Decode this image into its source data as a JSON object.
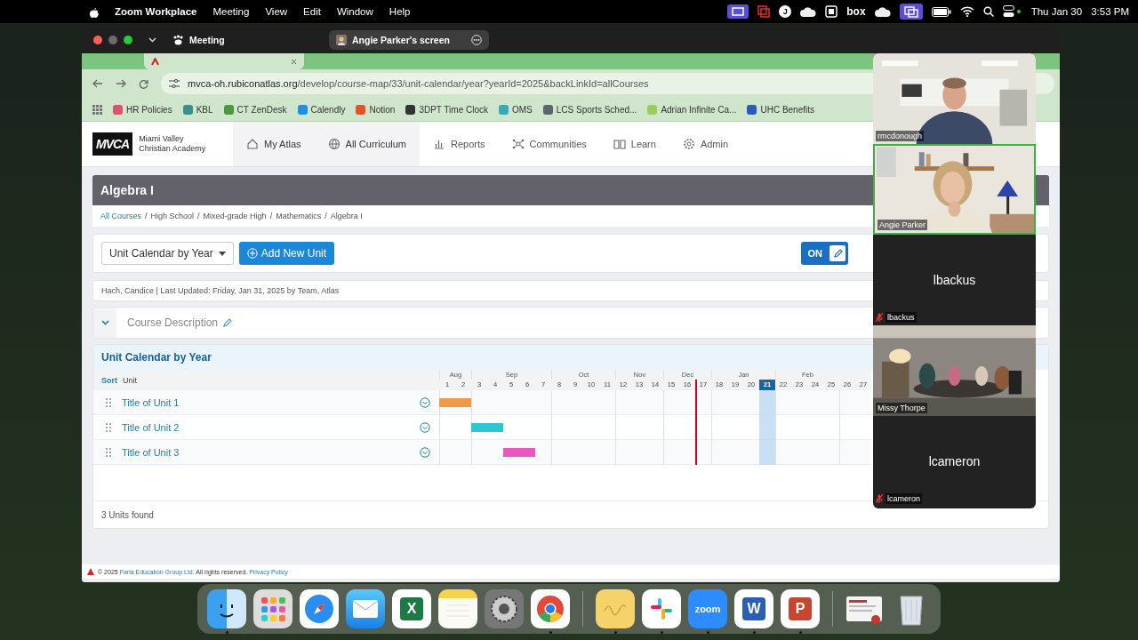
{
  "menubar": {
    "app": "Zoom Workplace",
    "menus": [
      "Meeting",
      "View",
      "Edit",
      "Window",
      "Help"
    ],
    "status_items": [
      {
        "kind": "share"
      },
      {
        "kind": "record"
      },
      {
        "kind": "badge",
        "label": "J"
      },
      {
        "kind": "cloud"
      },
      {
        "kind": "mail"
      },
      {
        "kind": "text",
        "label": "box"
      },
      {
        "kind": "cloud"
      },
      {
        "kind": "screens"
      },
      {
        "kind": "battery"
      },
      {
        "kind": "wifi"
      },
      {
        "kind": "search"
      },
      {
        "kind": "controls"
      }
    ],
    "date": "Thu Jan 30",
    "time": "3:53 PM"
  },
  "zoom_window": {
    "title": "Meeting",
    "share_pill": "Angie Parker's screen"
  },
  "browser": {
    "url_host": "mvca-oh.rubiconatlas.org",
    "url_path": "/develop/course-map/33/unit-calendar/year?yearId=2025&backLinkId=allCourses",
    "bookmarks": [
      {
        "label": "HR Policies",
        "color": "#d9546e"
      },
      {
        "label": "KBL",
        "color": "#3a8f8f"
      },
      {
        "label": "CT ZenDesk",
        "color": "#4a9a3c"
      },
      {
        "label": "Calendly",
        "color": "#1f8fe0"
      },
      {
        "label": "Notion",
        "color": "#e0562a"
      },
      {
        "label": "3DPT Time Clock",
        "color": "#333333"
      },
      {
        "label": "OMS",
        "color": "#3aa8b8"
      },
      {
        "label": "LCS Sports Sched...",
        "color": "#5c6470"
      },
      {
        "label": "Adrian Infinite Ca...",
        "color": "#9acd5a"
      },
      {
        "label": "UHC Benefits",
        "color": "#2a5cb8"
      }
    ]
  },
  "site": {
    "logo": "MVCA",
    "school_line_1": "Miami Valley",
    "school_line_2": "Christian Academy",
    "nav": [
      {
        "label": "My Atlas",
        "selected": true
      },
      {
        "label": "All Curriculum",
        "selected": true
      },
      {
        "label": "Reports",
        "selected": false
      },
      {
        "label": "Communities",
        "selected": false
      },
      {
        "label": "Learn",
        "selected": false
      },
      {
        "label": "Admin",
        "selected": false
      }
    ]
  },
  "course": {
    "title": "Algebra I",
    "breadcrumbs": [
      {
        "kind": "link",
        "label": "All Courses"
      },
      {
        "kind": "separator",
        "label": "/"
      },
      {
        "kind": "text",
        "label": "High School"
      },
      {
        "kind": "separator",
        "label": "/"
      },
      {
        "kind": "text",
        "label": "Mixed-grade High"
      },
      {
        "kind": "separator",
        "label": "/"
      },
      {
        "kind": "text",
        "label": "Mathematics"
      },
      {
        "kind": "separator",
        "label": "/"
      },
      {
        "kind": "text",
        "label": "Algebra I"
      }
    ],
    "view_select": "Unit Calendar by Year",
    "add_button": "Add New Unit",
    "edit_toggle": {
      "label": "ON",
      "on": true
    },
    "meta": "Hach, Candice | Last Updated: Friday, Jan 31, 2025 by Team, Atlas",
    "description": {
      "label": "Course Description",
      "expanded": true
    }
  },
  "calendar": {
    "title": "Unit Calendar by Year",
    "sort": "Sort",
    "unit_column": "Unit",
    "months": [
      "Aug",
      "Sep",
      "Oct",
      "Nov",
      "Dec",
      "Jan",
      "Feb"
    ],
    "weeks": [
      {
        "label": "1",
        "month_start": true,
        "selected": false,
        "today": false
      },
      {
        "label": "2",
        "month_start": false,
        "selected": false,
        "today": false
      },
      {
        "label": "3",
        "month_start": true,
        "selected": false,
        "today": false
      },
      {
        "label": "4",
        "month_start": false,
        "selected": false,
        "today": false
      },
      {
        "label": "5",
        "month_start": false,
        "selected": false,
        "today": false
      },
      {
        "label": "6",
        "month_start": false,
        "selected": false,
        "today": false
      },
      {
        "label": "7",
        "month_start": false,
        "selected": false,
        "today": false
      },
      {
        "label": "8",
        "month_start": true,
        "selected": false,
        "today": false
      },
      {
        "label": "9",
        "month_start": false,
        "selected": false,
        "today": false
      },
      {
        "label": "10",
        "month_start": false,
        "selected": false,
        "today": false
      },
      {
        "label": "11",
        "month_start": false,
        "selected": false,
        "today": false
      },
      {
        "label": "12",
        "month_start": true,
        "selected": false,
        "today": false
      },
      {
        "label": "13",
        "month_start": false,
        "selected": false,
        "today": false
      },
      {
        "label": "14",
        "month_start": false,
        "selected": false,
        "today": false
      },
      {
        "label": "15",
        "month_start": true,
        "selected": false,
        "today": false
      },
      {
        "label": "16",
        "month_start": false,
        "selected": false,
        "today": false
      },
      {
        "label": "17",
        "month_start": false,
        "selected": false,
        "today": true
      },
      {
        "label": "18",
        "month_start": true,
        "selected": false,
        "today": false
      },
      {
        "label": "19",
        "month_start": false,
        "selected": false,
        "today": false
      },
      {
        "label": "20",
        "month_start": false,
        "selected": false,
        "today": false
      },
      {
        "label": "21",
        "month_start": false,
        "selected": true,
        "today": false
      },
      {
        "label": "22",
        "month_start": true,
        "selected": false,
        "today": false
      },
      {
        "label": "23",
        "month_start": false,
        "selected": false,
        "today": false
      },
      {
        "label": "24",
        "month_start": false,
        "selected": false,
        "today": false
      },
      {
        "label": "25",
        "month_start": false,
        "selected": false,
        "today": false
      },
      {
        "label": "26",
        "month_start": true,
        "selected": false,
        "today": false
      },
      {
        "label": "27",
        "month_start": false,
        "selected": false,
        "today": false
      }
    ],
    "units": [
      {
        "title": "Title of Unit 1",
        "color": "#f0994a",
        "weeks": [
          true,
          true,
          false,
          false,
          false,
          false,
          false,
          false,
          false,
          false,
          false,
          false,
          false,
          false,
          false,
          false,
          false,
          false,
          false,
          false,
          false,
          false,
          false,
          false,
          false,
          false,
          false
        ]
      },
      {
        "title": "Title of Unit 2",
        "color": "#2ac8d0",
        "weeks": [
          false,
          false,
          true,
          true,
          false,
          false,
          false,
          false,
          false,
          false,
          false,
          false,
          false,
          false,
          false,
          false,
          false,
          false,
          false,
          false,
          false,
          false,
          false,
          false,
          false,
          false,
          false
        ]
      },
      {
        "title": "Title of Unit 3",
        "color": "#e858c0",
        "weeks": [
          false,
          false,
          false,
          false,
          true,
          true,
          false,
          false,
          false,
          false,
          false,
          false,
          false,
          false,
          false,
          false,
          false,
          false,
          false,
          false,
          false,
          false,
          false,
          false,
          false,
          false,
          false
        ]
      }
    ],
    "count": "3 Units found"
  },
  "footer": {
    "prefix": "© 2025",
    "company_link": "Faria Education Group Ltd.",
    "rights": "All rights reserved.",
    "privacy_link": "Privacy Policy"
  },
  "participants": [
    {
      "name": "rmcdonough",
      "kind": "video",
      "muted": false,
      "speaking": false
    },
    {
      "name": "Angie Parker",
      "kind": "video",
      "muted": false,
      "speaking": true
    },
    {
      "name": "lbackus",
      "display_name": "lbackus",
      "kind": "avatar",
      "muted": true,
      "speaking": false
    },
    {
      "name": "Missy Thorpe",
      "kind": "video",
      "muted": false,
      "speaking": false
    },
    {
      "name": "lcameron",
      "display_name": "lcameron",
      "kind": "avatar",
      "muted": true,
      "speaking": false
    }
  ],
  "dock": [
    {
      "kind": "finder",
      "running": true
    },
    {
      "kind": "launchpad",
      "running": false
    },
    {
      "kind": "safari",
      "running": false
    },
    {
      "kind": "mail",
      "running": false
    },
    {
      "kind": "office",
      "label": "X",
      "color": "#1d7a45",
      "running": false
    },
    {
      "kind": "notes",
      "running": false
    },
    {
      "kind": "settings",
      "running": false
    },
    {
      "kind": "chrome",
      "running": true
    },
    {
      "kind": "separator"
    },
    {
      "kind": "stickies",
      "running": true
    },
    {
      "kind": "slack",
      "running": true
    },
    {
      "kind": "zoom",
      "label": "zoom",
      "running": true
    },
    {
      "kind": "office",
      "label": "W",
      "color": "#2b5fb4",
      "running": true
    },
    {
      "kind": "office",
      "label": "P",
      "color": "#c8452f",
      "running": true
    },
    {
      "kind": "separator"
    },
    {
      "kind": "preview",
      "running": false
    },
    {
      "kind": "trash",
      "running": false
    }
  ]
}
